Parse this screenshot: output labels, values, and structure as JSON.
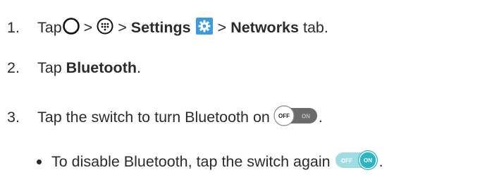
{
  "steps": [
    {
      "number": "1.",
      "text_tap": "Tap",
      "sep1": ">",
      "sep2": ">",
      "settings": "Settings",
      "sep3": ">",
      "networks": "Networks",
      "tab": "tab."
    },
    {
      "number": "2.",
      "text_tap": "Tap",
      "bluetooth": "Bluetooth",
      "period": "."
    },
    {
      "number": "3.",
      "text": "Tap the switch to turn Bluetooth on",
      "period": "."
    }
  ],
  "sub_bullet": {
    "text": "To disable Bluetooth, tap the switch again",
    "period": "."
  },
  "switch_off": {
    "off_label": "OFF",
    "on_label": "ON"
  },
  "switch_on": {
    "off_label": "OFF",
    "on_label": "ON"
  },
  "colors": {
    "text": "#2b2b2b",
    "settings_icon_bg": "#3a9be0",
    "switch_on_teal": "#27b6c2",
    "switch_off_gray": "#6b6b6b"
  },
  "icons": [
    "home-circle-icon",
    "apps-dots-icon",
    "settings-gear-icon",
    "toggle-off-icon",
    "toggle-on-icon"
  ]
}
